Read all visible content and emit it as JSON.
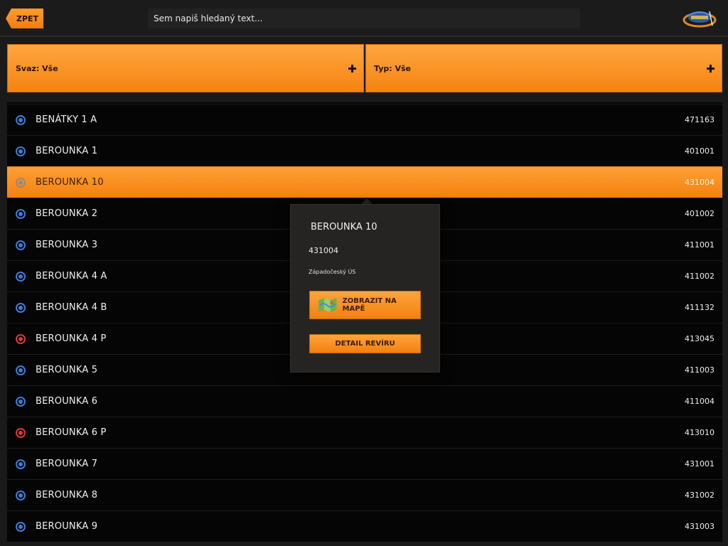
{
  "header": {
    "back_label": "ZPET",
    "search_placeholder": "Sem napiš hledaný text...",
    "logo_icon": "fishing-logo-icon"
  },
  "filters": [
    {
      "label": "Svaz: Vše"
    },
    {
      "label": "Typ: Vše"
    }
  ],
  "colors": {
    "accent": "#f5830f",
    "marker_blue": "#3f7cd6",
    "marker_red": "#d83a36"
  },
  "list": {
    "items": [
      {
        "name": "BENÁTKY 1 A",
        "code": "471163",
        "marker": "blue"
      },
      {
        "name": "BEROUNKA 1",
        "code": "401001",
        "marker": "blue"
      },
      {
        "name": "BEROUNKA 10",
        "code": "431004",
        "marker": "gray",
        "selected": true
      },
      {
        "name": "BEROUNKA 2",
        "code": "401002",
        "marker": "blue"
      },
      {
        "name": "BEROUNKA 3",
        "code": "411001",
        "marker": "blue"
      },
      {
        "name": "BEROUNKA 4 A",
        "code": "411002",
        "marker": "blue"
      },
      {
        "name": "BEROUNKA 4 B",
        "code": "411132",
        "marker": "blue"
      },
      {
        "name": "BEROUNKA 4 P",
        "code": "413045",
        "marker": "red"
      },
      {
        "name": "BEROUNKA 5",
        "code": "411003",
        "marker": "blue"
      },
      {
        "name": "BEROUNKA 6",
        "code": "411004",
        "marker": "blue"
      },
      {
        "name": "BEROUNKA 6 P",
        "code": "413010",
        "marker": "red"
      },
      {
        "name": "BEROUNKA 7",
        "code": "431001",
        "marker": "blue"
      },
      {
        "name": "BEROUNKA 8",
        "code": "431002",
        "marker": "blue"
      },
      {
        "name": "BEROUNKA 9",
        "code": "431003",
        "marker": "blue"
      }
    ]
  },
  "popover": {
    "title": "BEROUNKA 10",
    "code": "431004",
    "union": "Západočeský ÚS",
    "map_button": "ZOBRAZIT NA MAPĚ",
    "map_icon": "map-icon",
    "detail_button": "DETAIL REVÍRU"
  }
}
